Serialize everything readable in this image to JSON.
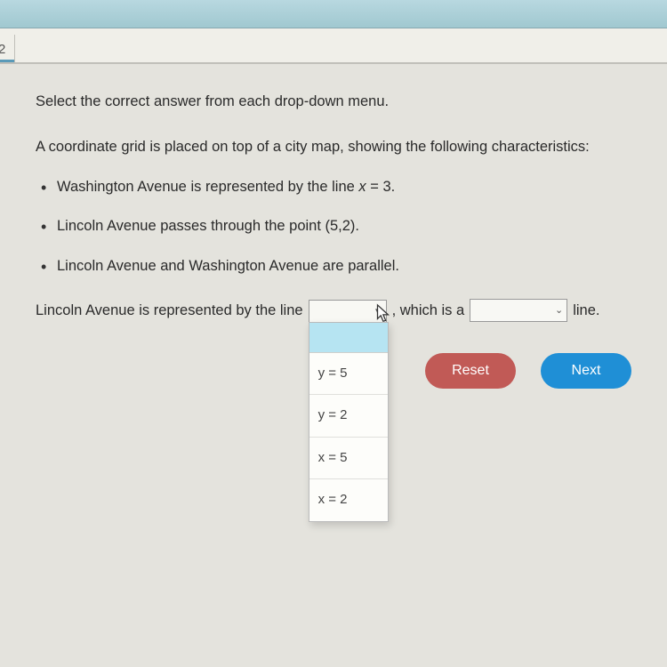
{
  "tabBar": {
    "tabLabel": "2"
  },
  "instruction": "Select the correct answer from each drop-down menu.",
  "problemStatement": "A coordinate grid is placed on top of a city map, showing the following characteristics:",
  "bullets": [
    {
      "pre": "Washington Avenue is represented by the line ",
      "mathVar": "x",
      "mathRest": " = 3."
    },
    {
      "full": "Lincoln Avenue passes through the point (5,2)."
    },
    {
      "full": "Lincoln Avenue and Washington Avenue are parallel."
    }
  ],
  "answer": {
    "text1": "Lincoln Avenue is represented by the line",
    "text2": ", which is a",
    "text3": "line."
  },
  "dropdown1": {
    "options": [
      "y = 5",
      "y = 2",
      "x = 5",
      "x = 2"
    ]
  },
  "buttons": {
    "reset": "Reset",
    "next": "Next"
  }
}
